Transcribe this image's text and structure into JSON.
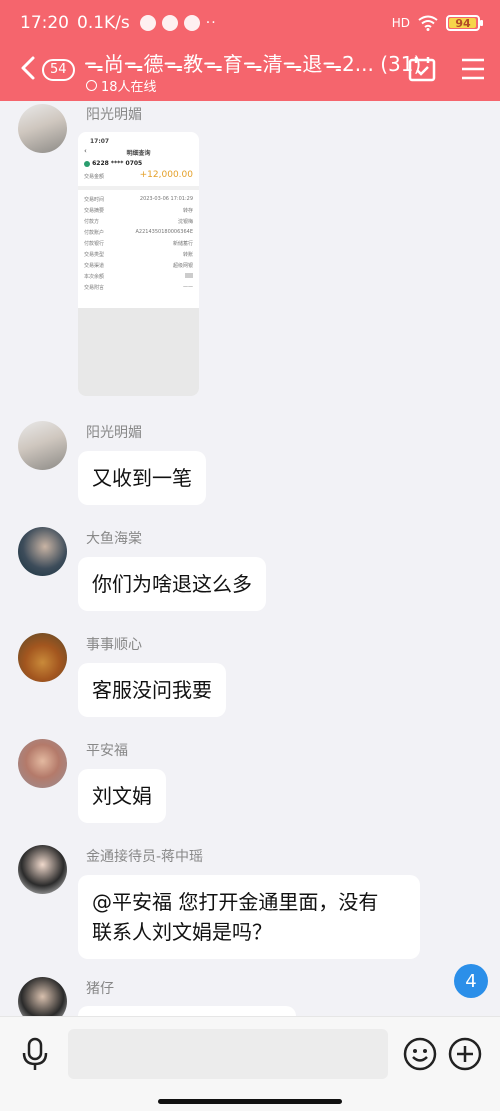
{
  "status_bar": {
    "time": "17:20",
    "network_speed": "0.1K/s",
    "signal": "HD",
    "battery": "94"
  },
  "header": {
    "back_badge": "54",
    "title": "ᯓ尚ᯓ德ᯓ教ᯓ育ᯓ清ᯓ退ᯓ2... (31)",
    "online": "18人在线",
    "accent": "#f5656d"
  },
  "screenshot_bubble": {
    "time": "17:07",
    "page_title": "明细查询",
    "card": "6228 **** 0705",
    "amount_label": "交易金额",
    "amount": "+12,000.00",
    "rows": [
      {
        "k": "交易时间",
        "v": "2023-03-06 17:01:29"
      },
      {
        "k": "交易摘要",
        "v": "转存"
      },
      {
        "k": "付款方",
        "v": "沈银梅"
      },
      {
        "k": "付款账户",
        "v": "A2214350180006364E"
      },
      {
        "k": "付款银行",
        "v": "新储蓄行"
      },
      {
        "k": "交易类型",
        "v": "转账"
      },
      {
        "k": "交易渠道",
        "v": "超级网银"
      },
      {
        "k": "本次余额",
        "v": ""
      },
      {
        "k": "交易附言",
        "v": "——"
      }
    ]
  },
  "messages": [
    {
      "sender": "阳光明媚",
      "text": ""
    },
    {
      "sender": "阳光明媚",
      "text": "又收到一笔"
    },
    {
      "sender": "大鱼海棠",
      "text": "你们为啥退这么多"
    },
    {
      "sender": "事事顺心",
      "text": "客服没问我要"
    },
    {
      "sender": "平安福",
      "text": "刘文娟"
    },
    {
      "sender": "金通接待员-蒋中瑶",
      "text_line1": "@平安福 您打开金通里面，没有",
      "text_line2": "联系人刘文娟是吗？"
    },
    {
      "sender": "猪仔",
      "text": ""
    }
  ],
  "unread_count": "4"
}
